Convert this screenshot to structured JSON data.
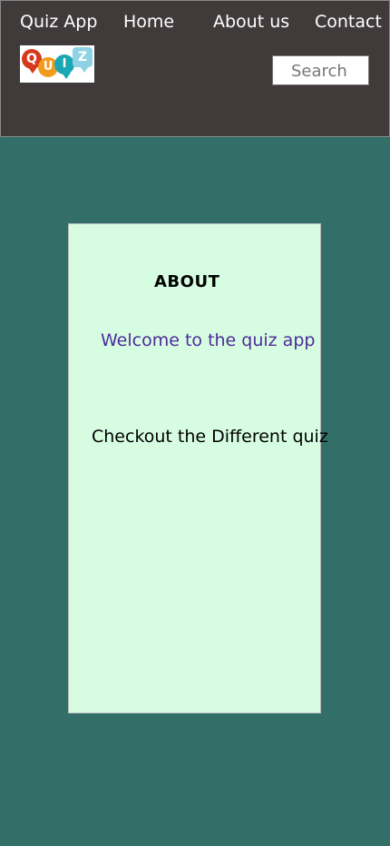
{
  "header": {
    "brand": "Quiz App",
    "nav": {
      "home": "Home",
      "about": "About us",
      "contact": "Contact"
    },
    "logo": {
      "letters": [
        "Q",
        "U",
        "I",
        "Z"
      ],
      "colors": [
        "#d6391c",
        "#f29b1d",
        "#1aa7b4",
        "#8fd2e3"
      ]
    },
    "search": {
      "placeholder": "Search",
      "value": ""
    }
  },
  "main": {
    "title": "ABOUT",
    "welcome": "Welcome to the quiz app",
    "description": "Checkout the Different quiz"
  },
  "colors": {
    "header_bg": "#403a3b",
    "page_bg": "#326f69",
    "card_bg": "#d6fde1",
    "welcome_text": "#4d2b9a"
  }
}
